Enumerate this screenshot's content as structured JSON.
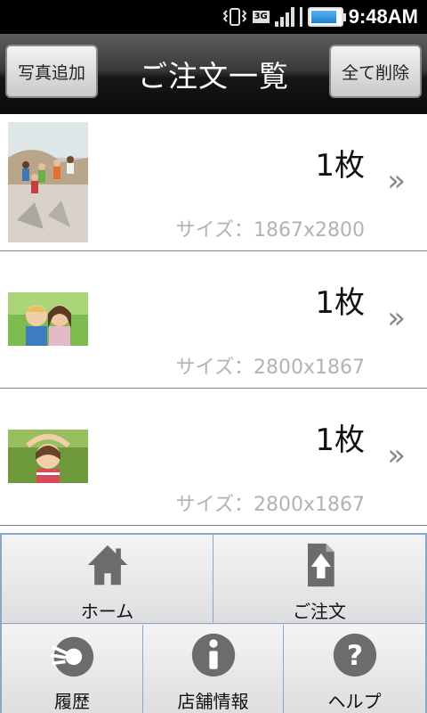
{
  "status_bar": {
    "time": "9:48AM",
    "network": "3G",
    "battery_level": 0.78,
    "icons": [
      "vibrate-icon",
      "3g-icon",
      "signal-icon",
      "battery-icon"
    ]
  },
  "header": {
    "left_button": "写真追加",
    "title": "ご注文一覧",
    "right_button": "全て削除"
  },
  "orders": [
    {
      "count": "1枚",
      "size": "サイズ：1867x2800",
      "thumb": "beach-kids-photo"
    },
    {
      "count": "1枚",
      "size": "サイズ：2800x1867",
      "thumb": "two-children-photo"
    },
    {
      "count": "1枚",
      "size": "サイズ：2800x1867",
      "thumb": "girl-photo"
    }
  ],
  "menu": {
    "items": [
      {
        "label": "ホーム",
        "icon": "home-icon"
      },
      {
        "label": "ご注文",
        "icon": "order-upload-icon"
      },
      {
        "label": "履歴",
        "icon": "history-icon"
      },
      {
        "label": "店舗情報",
        "icon": "info-icon"
      },
      {
        "label": "ヘルプ",
        "icon": "help-icon"
      }
    ]
  },
  "colors": {
    "menu_border": "#8aa7c9",
    "size_text": "#b3b3b3",
    "header_dark": "#0a0a0a"
  }
}
